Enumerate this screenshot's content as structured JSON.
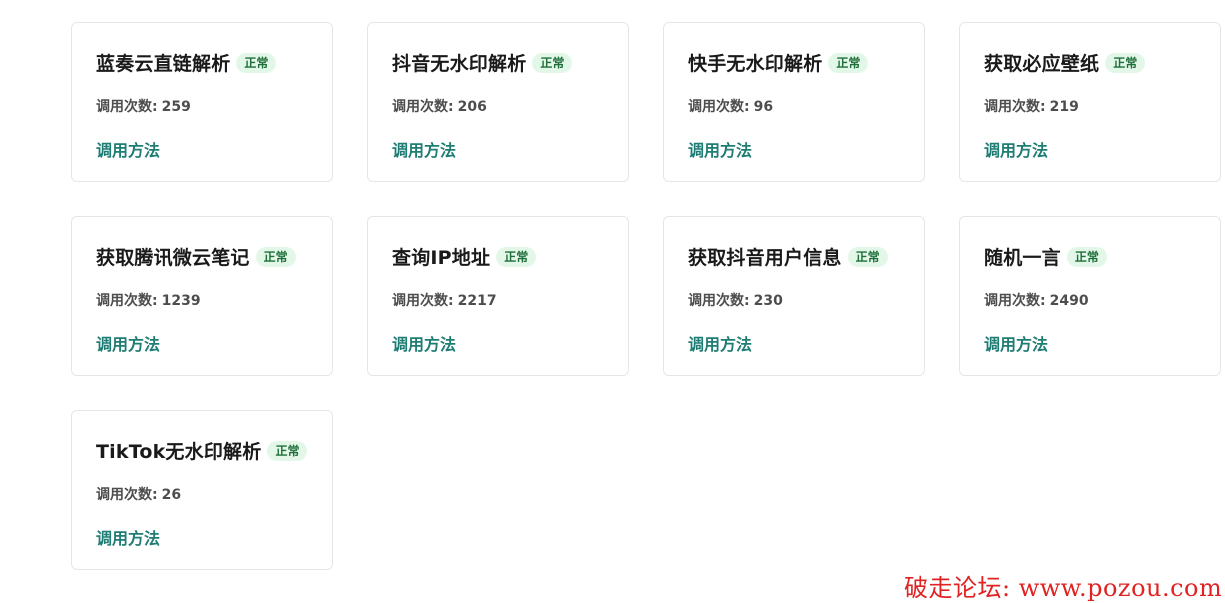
{
  "cards": [
    {
      "title": "蓝奏云直链解析",
      "status": "正常",
      "calls_label": "调用次数:",
      "calls": "259",
      "link": "调用方法"
    },
    {
      "title": "抖音无水印解析",
      "status": "正常",
      "calls_label": "调用次数:",
      "calls": "206",
      "link": "调用方法"
    },
    {
      "title": "快手无水印解析",
      "status": "正常",
      "calls_label": "调用次数:",
      "calls": "96",
      "link": "调用方法"
    },
    {
      "title": "获取必应壁纸",
      "status": "正常",
      "calls_label": "调用次数:",
      "calls": "219",
      "link": "调用方法"
    },
    {
      "title": "获取腾讯微云笔记",
      "status": "正常",
      "calls_label": "调用次数:",
      "calls": "1239",
      "link": "调用方法"
    },
    {
      "title": "查询IP地址",
      "status": "正常",
      "calls_label": "调用次数:",
      "calls": "2217",
      "link": "调用方法"
    },
    {
      "title": "获取抖音用户信息",
      "status": "正常",
      "calls_label": "调用次数:",
      "calls": "230",
      "link": "调用方法"
    },
    {
      "title": "随机一言",
      "status": "正常",
      "calls_label": "调用次数:",
      "calls": "2490",
      "link": "调用方法"
    },
    {
      "title": "TikTok无水印解析",
      "status": "正常",
      "calls_label": "调用次数:",
      "calls": "26",
      "link": "调用方法"
    }
  ],
  "colors": {
    "status_text": "#1f6f3a",
    "status_bg": "#e3f7e8",
    "link": "#1f7d74",
    "watermark": "#e02222"
  },
  "watermark": "破走论坛: www.pozou.com"
}
